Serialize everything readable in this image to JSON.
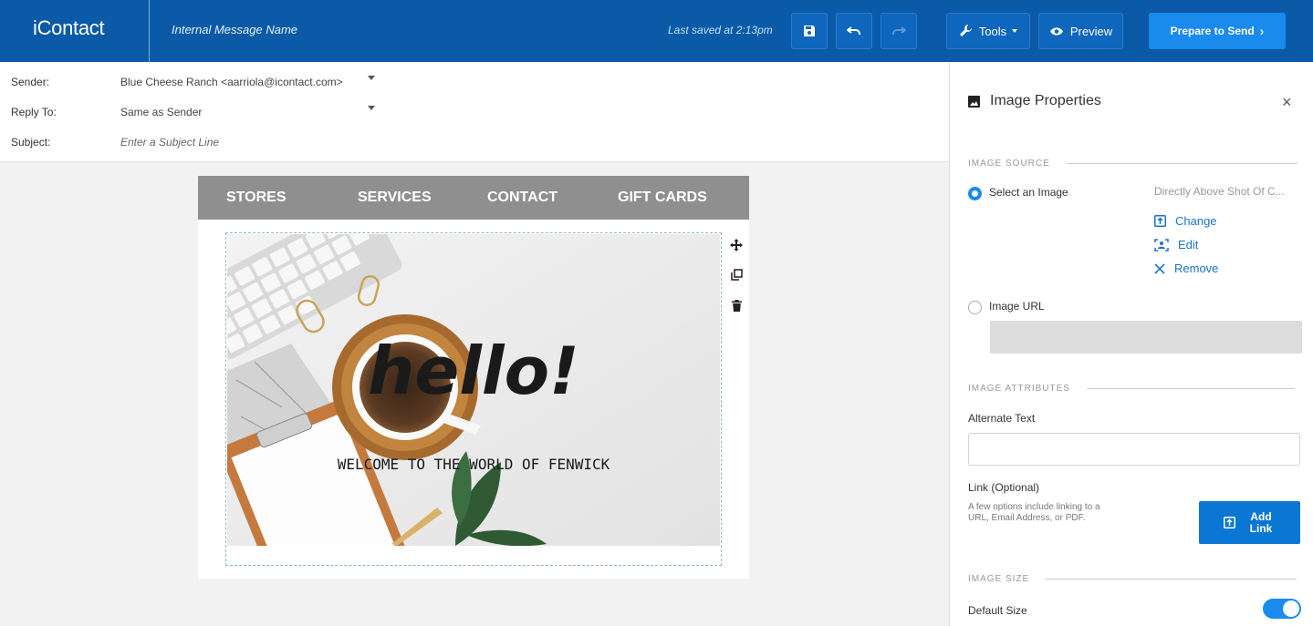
{
  "app": {
    "logo": "iContact",
    "message_name": "Internal Message Name",
    "last_saved": "Last saved at 2:13pm",
    "tools_label": "Tools",
    "preview_label": "Preview",
    "send_label": "Prepare to Send"
  },
  "header": {
    "sender_label": "Sender:",
    "sender_value": "Blue Cheese Ranch <aarriola@icontact.com>",
    "reply_label": "Reply To:",
    "reply_value": "Same as Sender",
    "subject_label": "Subject:",
    "subject_placeholder": "Enter a Subject Line"
  },
  "email": {
    "nav": [
      "STORES",
      "SERVICES",
      "CONTACT",
      "GIFT CARDS"
    ],
    "hero_heading": "hello!",
    "hero_sub": "WELCOME TO THE WORLD OF FENWICK"
  },
  "panel": {
    "title": "Image Properties",
    "close": "×",
    "image_source_label": "IMAGE SOURCE",
    "select_image_label": "Select an Image",
    "selected_file": "Directly Above Shot Of C...",
    "change_label": "Change",
    "edit_label": "Edit",
    "remove_label": "Remove",
    "image_url_label": "Image URL",
    "image_attributes_label": "IMAGE ATTRIBUTES",
    "alt_text_label": "Alternate Text",
    "link_label": "Link (Optional)",
    "link_helper": "A few options include linking to a URL, Email Address, or PDF.",
    "add_link_label": "Add Link",
    "image_size_label": "IMAGE SIZE",
    "default_size_label": "Default Size"
  },
  "colors": {
    "topbar": "#0a5aa8",
    "accent": "#1a8aed",
    "nav_bg": "#8f8f8f"
  }
}
